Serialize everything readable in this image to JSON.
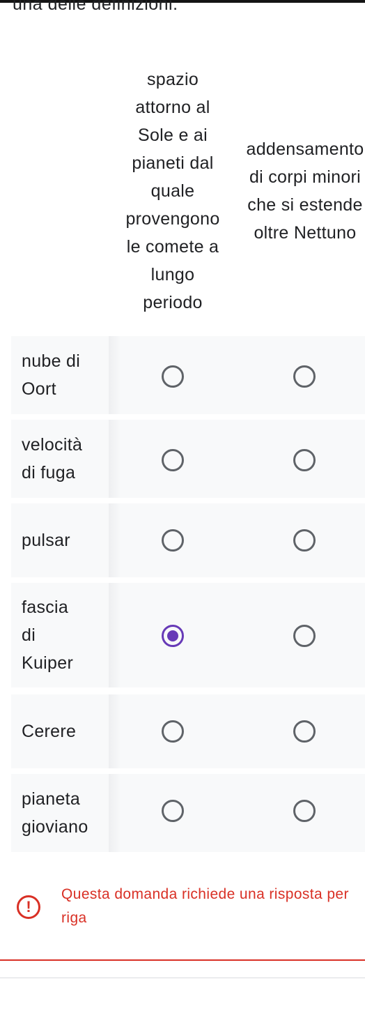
{
  "intro_text": "una delle definizioni.",
  "columns": [
    {
      "lines": [
        "spazio",
        "attorno al",
        "Sole e ai",
        "pianeti dal",
        "quale",
        "provengono",
        "le comete a",
        "lungo",
        "periodo"
      ]
    },
    {
      "lines": [
        "addensamento",
        "di corpi minori",
        "che si estende",
        "oltre Nettuno"
      ]
    }
  ],
  "rows": [
    {
      "lines": [
        "nube di",
        "Oort"
      ],
      "selected": null
    },
    {
      "lines": [
        "velocità",
        "di fuga"
      ],
      "selected": null
    },
    {
      "lines": [
        "pulsar"
      ],
      "selected": null
    },
    {
      "lines": [
        "fascia",
        "di",
        "Kuiper"
      ],
      "selected": 0
    },
    {
      "lines": [
        "Cerere"
      ],
      "selected": null
    },
    {
      "lines": [
        "pianeta",
        "gioviano"
      ],
      "selected": null
    }
  ],
  "error": {
    "lines": [
      "Questa domanda richiede una risposta per",
      "riga"
    ],
    "icon": "!"
  },
  "colors": {
    "accent": "#673ab7",
    "error": "#d93025",
    "row_bg": "#f8f9fa"
  }
}
